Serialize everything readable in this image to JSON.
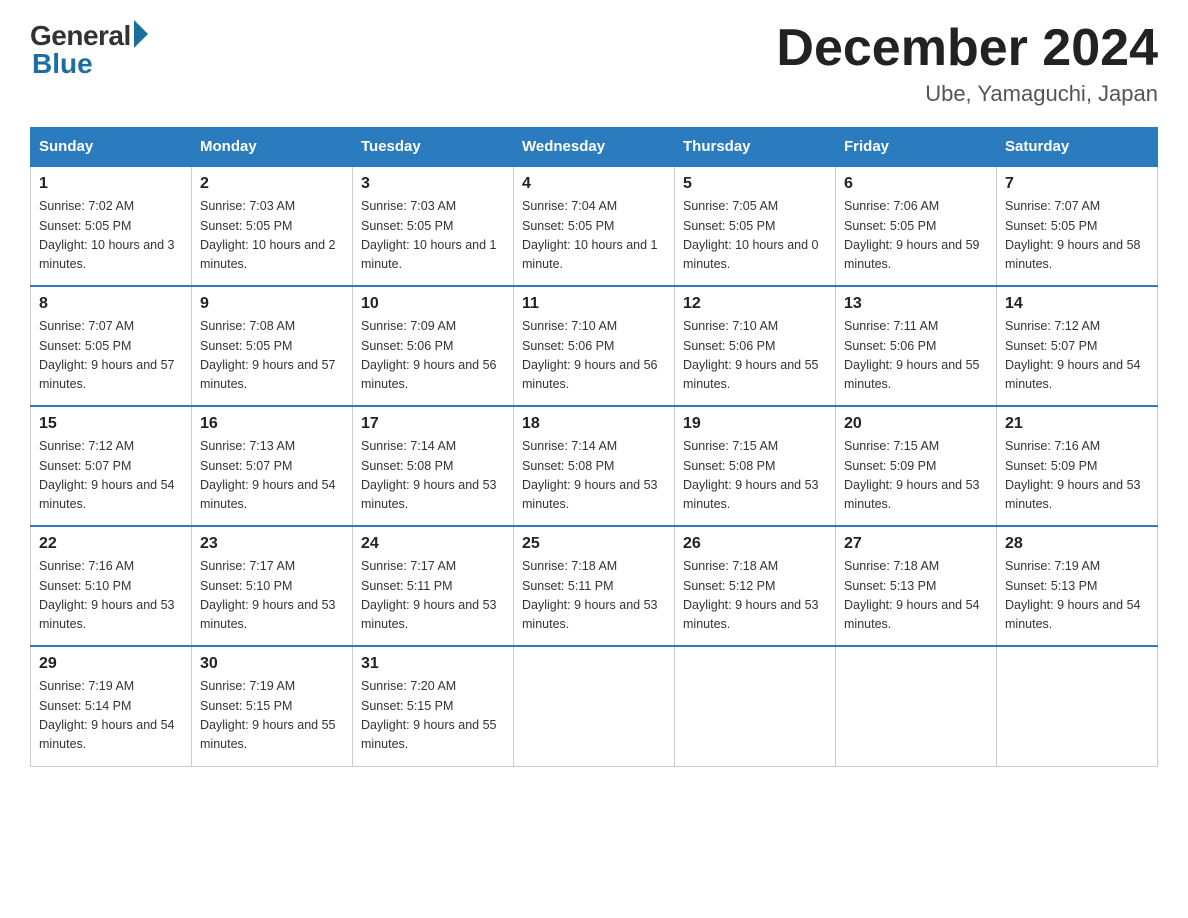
{
  "logo": {
    "general": "General",
    "blue": "Blue"
  },
  "title": "December 2024",
  "subtitle": "Ube, Yamaguchi, Japan",
  "days_header": [
    "Sunday",
    "Monday",
    "Tuesday",
    "Wednesday",
    "Thursday",
    "Friday",
    "Saturday"
  ],
  "weeks": [
    [
      {
        "day": "1",
        "sunrise": "7:02 AM",
        "sunset": "5:05 PM",
        "daylight": "10 hours and 3 minutes."
      },
      {
        "day": "2",
        "sunrise": "7:03 AM",
        "sunset": "5:05 PM",
        "daylight": "10 hours and 2 minutes."
      },
      {
        "day": "3",
        "sunrise": "7:03 AM",
        "sunset": "5:05 PM",
        "daylight": "10 hours and 1 minute."
      },
      {
        "day": "4",
        "sunrise": "7:04 AM",
        "sunset": "5:05 PM",
        "daylight": "10 hours and 1 minute."
      },
      {
        "day": "5",
        "sunrise": "7:05 AM",
        "sunset": "5:05 PM",
        "daylight": "10 hours and 0 minutes."
      },
      {
        "day": "6",
        "sunrise": "7:06 AM",
        "sunset": "5:05 PM",
        "daylight": "9 hours and 59 minutes."
      },
      {
        "day": "7",
        "sunrise": "7:07 AM",
        "sunset": "5:05 PM",
        "daylight": "9 hours and 58 minutes."
      }
    ],
    [
      {
        "day": "8",
        "sunrise": "7:07 AM",
        "sunset": "5:05 PM",
        "daylight": "9 hours and 57 minutes."
      },
      {
        "day": "9",
        "sunrise": "7:08 AM",
        "sunset": "5:05 PM",
        "daylight": "9 hours and 57 minutes."
      },
      {
        "day": "10",
        "sunrise": "7:09 AM",
        "sunset": "5:06 PM",
        "daylight": "9 hours and 56 minutes."
      },
      {
        "day": "11",
        "sunrise": "7:10 AM",
        "sunset": "5:06 PM",
        "daylight": "9 hours and 56 minutes."
      },
      {
        "day": "12",
        "sunrise": "7:10 AM",
        "sunset": "5:06 PM",
        "daylight": "9 hours and 55 minutes."
      },
      {
        "day": "13",
        "sunrise": "7:11 AM",
        "sunset": "5:06 PM",
        "daylight": "9 hours and 55 minutes."
      },
      {
        "day": "14",
        "sunrise": "7:12 AM",
        "sunset": "5:07 PM",
        "daylight": "9 hours and 54 minutes."
      }
    ],
    [
      {
        "day": "15",
        "sunrise": "7:12 AM",
        "sunset": "5:07 PM",
        "daylight": "9 hours and 54 minutes."
      },
      {
        "day": "16",
        "sunrise": "7:13 AM",
        "sunset": "5:07 PM",
        "daylight": "9 hours and 54 minutes."
      },
      {
        "day": "17",
        "sunrise": "7:14 AM",
        "sunset": "5:08 PM",
        "daylight": "9 hours and 53 minutes."
      },
      {
        "day": "18",
        "sunrise": "7:14 AM",
        "sunset": "5:08 PM",
        "daylight": "9 hours and 53 minutes."
      },
      {
        "day": "19",
        "sunrise": "7:15 AM",
        "sunset": "5:08 PM",
        "daylight": "9 hours and 53 minutes."
      },
      {
        "day": "20",
        "sunrise": "7:15 AM",
        "sunset": "5:09 PM",
        "daylight": "9 hours and 53 minutes."
      },
      {
        "day": "21",
        "sunrise": "7:16 AM",
        "sunset": "5:09 PM",
        "daylight": "9 hours and 53 minutes."
      }
    ],
    [
      {
        "day": "22",
        "sunrise": "7:16 AM",
        "sunset": "5:10 PM",
        "daylight": "9 hours and 53 minutes."
      },
      {
        "day": "23",
        "sunrise": "7:17 AM",
        "sunset": "5:10 PM",
        "daylight": "9 hours and 53 minutes."
      },
      {
        "day": "24",
        "sunrise": "7:17 AM",
        "sunset": "5:11 PM",
        "daylight": "9 hours and 53 minutes."
      },
      {
        "day": "25",
        "sunrise": "7:18 AM",
        "sunset": "5:11 PM",
        "daylight": "9 hours and 53 minutes."
      },
      {
        "day": "26",
        "sunrise": "7:18 AM",
        "sunset": "5:12 PM",
        "daylight": "9 hours and 53 minutes."
      },
      {
        "day": "27",
        "sunrise": "7:18 AM",
        "sunset": "5:13 PM",
        "daylight": "9 hours and 54 minutes."
      },
      {
        "day": "28",
        "sunrise": "7:19 AM",
        "sunset": "5:13 PM",
        "daylight": "9 hours and 54 minutes."
      }
    ],
    [
      {
        "day": "29",
        "sunrise": "7:19 AM",
        "sunset": "5:14 PM",
        "daylight": "9 hours and 54 minutes."
      },
      {
        "day": "30",
        "sunrise": "7:19 AM",
        "sunset": "5:15 PM",
        "daylight": "9 hours and 55 minutes."
      },
      {
        "day": "31",
        "sunrise": "7:20 AM",
        "sunset": "5:15 PM",
        "daylight": "9 hours and 55 minutes."
      },
      null,
      null,
      null,
      null
    ]
  ]
}
